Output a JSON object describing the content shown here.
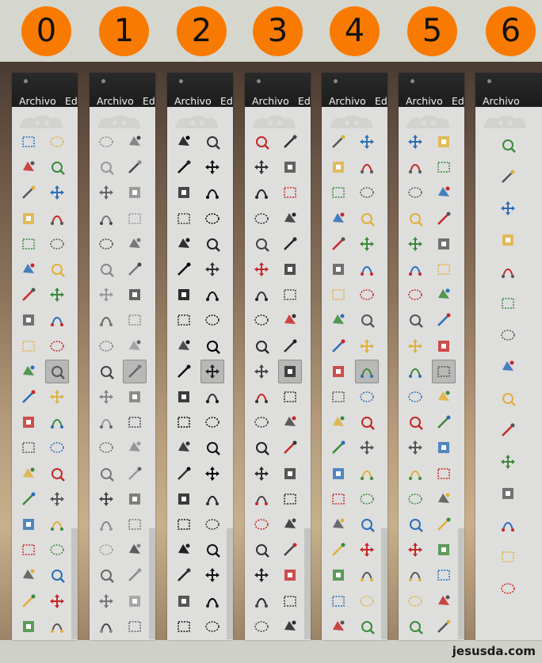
{
  "badges": [
    "0",
    "1",
    "2",
    "3",
    "4",
    "5",
    "6"
  ],
  "menu": {
    "file": "Archivo",
    "edit": "Edi"
  },
  "watermark": "jesusda.com",
  "colors": {
    "badge": "#f97a00",
    "header": "#1f1f1f",
    "panel": "#dededd"
  },
  "tool_icons": [
    "rect-select-icon",
    "ellipse-select-icon",
    "free-select-icon",
    "fuzzy-select-icon",
    "color-select-icon",
    "scissors-select-icon",
    "foreground-select-icon",
    "paths-icon",
    "color-picker-icon",
    "zoom-icon",
    "measure-icon",
    "move-icon",
    "align-icon",
    "crop-icon",
    "rotate-icon",
    "scale-icon",
    "shear-icon",
    "perspective-icon",
    "flip-icon",
    "cage-icon",
    "text-icon",
    "bucket-fill-icon",
    "blend-icon",
    "pencil-icon",
    "paintbrush-icon",
    "eraser-icon",
    "airbrush-icon",
    "ink-icon",
    "clone-icon",
    "heal-icon",
    "perspective-clone-icon",
    "blur-icon",
    "smudge-icon",
    "dodge-burn-icon",
    "levels-icon",
    "curves-icon",
    "color-balance-icon",
    "brightness-icon",
    "channel-icon",
    "gegl-icon"
  ],
  "panel6_icons": [
    "rect-select-icon",
    "ellipse-select-icon",
    "free-select-icon",
    "fuzzy-select-icon",
    "color-select-icon",
    "scissors-select-icon",
    "foreground-select-icon",
    "paths-icon",
    "color-picker-icon",
    "zoom-icon",
    "measure-icon",
    "move-icon",
    "align-icon",
    "crop-icon",
    "rotate-icon"
  ]
}
